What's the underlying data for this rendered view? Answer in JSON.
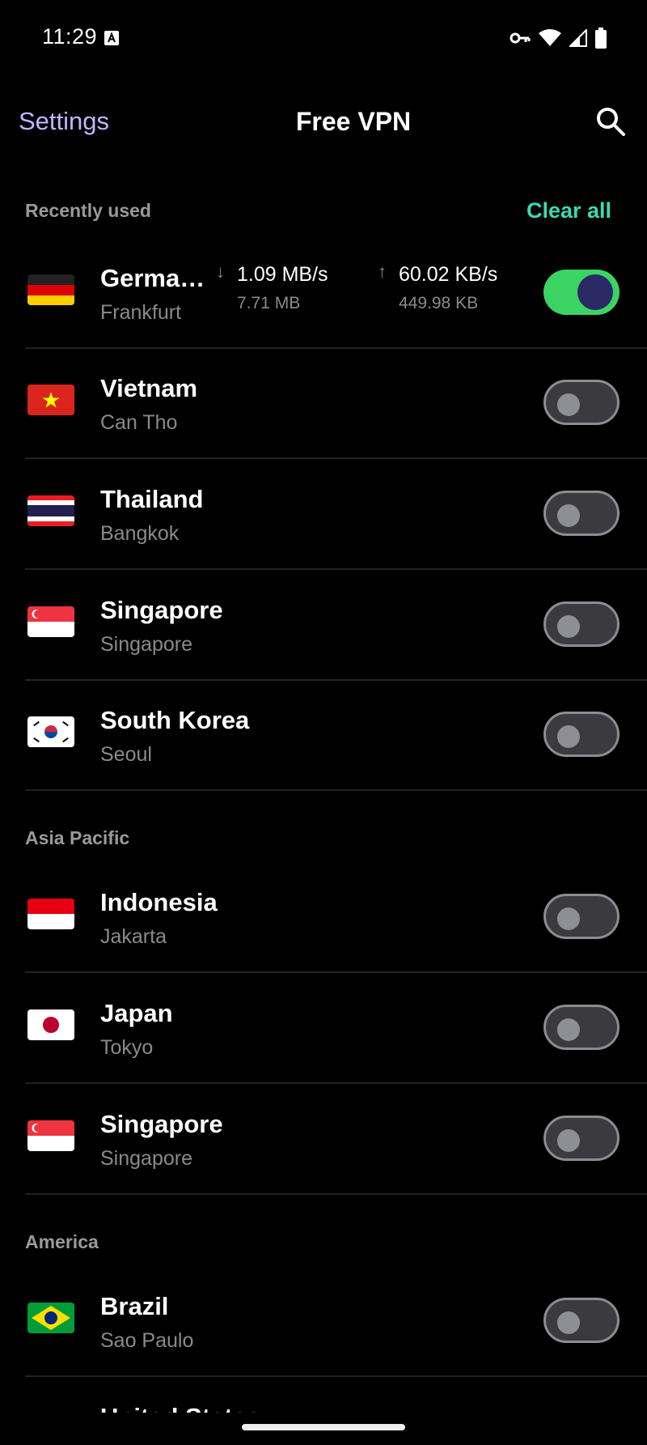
{
  "status_bar": {
    "time": "11:29",
    "icons": [
      "a-notification-icon",
      "vpn-key-icon",
      "wifi-icon",
      "signal-icon",
      "battery-icon"
    ]
  },
  "app_bar": {
    "back_label": "Settings",
    "title": "Free VPN",
    "search_icon": "search-icon"
  },
  "sections": {
    "recent": {
      "title": "Recently used",
      "action": "Clear all"
    },
    "asia": {
      "title": "Asia Pacific"
    },
    "america": {
      "title": "America"
    }
  },
  "connected": {
    "country": "Germa…",
    "city": "Frankfurt",
    "download": {
      "rate": "1.09 MB/s",
      "total": "7.71 MB"
    },
    "upload": {
      "rate": "60.02 KB/s",
      "total": "449.98 KB"
    },
    "connected": true
  },
  "recent_rows": [
    {
      "country": "Vietnam",
      "city": "Can Tho",
      "flag": "vietnam-flag"
    },
    {
      "country": "Thailand",
      "city": "Bangkok",
      "flag": "thailand-flag"
    },
    {
      "country": "Singapore",
      "city": "Singapore",
      "flag": "singapore-flag"
    },
    {
      "country": "South Korea",
      "city": "Seoul",
      "flag": "south-korea-flag"
    }
  ],
  "asia_rows": [
    {
      "country": "Indonesia",
      "city": "Jakarta",
      "flag": "indonesia-flag"
    },
    {
      "country": "Japan",
      "city": "Tokyo",
      "flag": "japan-flag"
    },
    {
      "country": "Singapore",
      "city": "Singapore",
      "flag": "singapore-flag"
    }
  ],
  "america_rows": [
    {
      "country": "Brazil",
      "city": "Sao Paulo",
      "flag": "brazil-flag"
    },
    {
      "country": "United States",
      "city": "",
      "flag": ""
    }
  ],
  "colors": {
    "accent_link": "#c2b4ff",
    "clear_all": "#3ad9b4",
    "toggle_on": "#3bd463",
    "toggle_knob_on": "#2b2966",
    "background": "#000000"
  }
}
